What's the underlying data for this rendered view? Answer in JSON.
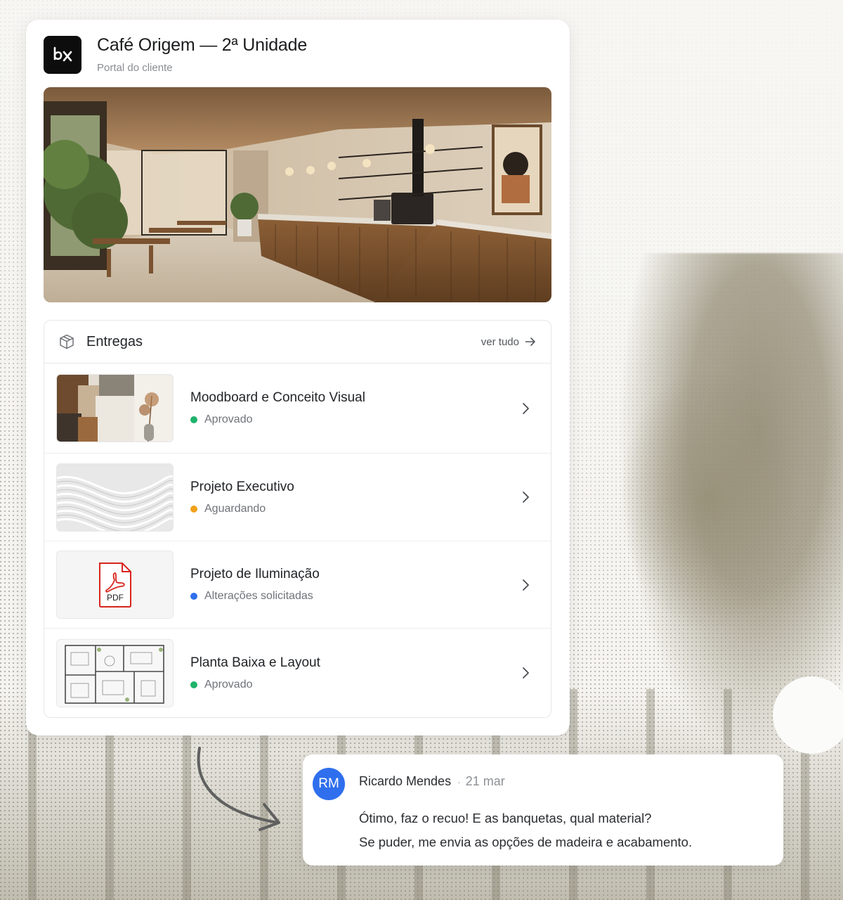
{
  "project": {
    "title": "Café Origem — 2ª Unidade",
    "subtitle": "Portal do cliente",
    "logo_icon": "bx-logo-icon"
  },
  "deliveries": {
    "heading": "Entregas",
    "heading_icon": "package-icon",
    "see_all_label": "ver tudo",
    "items": [
      {
        "title": "Moodboard e Conceito Visual",
        "status": "Aprovado",
        "status_color": "#1fb36b",
        "thumb": "moodboard"
      },
      {
        "title": "Projeto Executivo",
        "status": "Aguardando",
        "status_color": "#f0a11b",
        "thumb": "abstract-3d"
      },
      {
        "title": "Projeto de Iluminação",
        "status": "Alterações solicitadas",
        "status_color": "#2f6fed",
        "thumb": "pdf-file",
        "thumb_label": "PDF"
      },
      {
        "title": "Planta Baixa e Layout",
        "status": "Aprovado",
        "status_color": "#1fb36b",
        "thumb": "floor-plan"
      }
    ]
  },
  "comment": {
    "avatar_initials": "RM",
    "avatar_color": "#2f6fed",
    "author": "Ricardo Mendes",
    "separator": "·",
    "date": "21 mar",
    "line1": "Ótimo, faz o recuo! E as banquetas, qual material?",
    "line2": "Se puder, me envia as opções de madeira e acabamento."
  }
}
